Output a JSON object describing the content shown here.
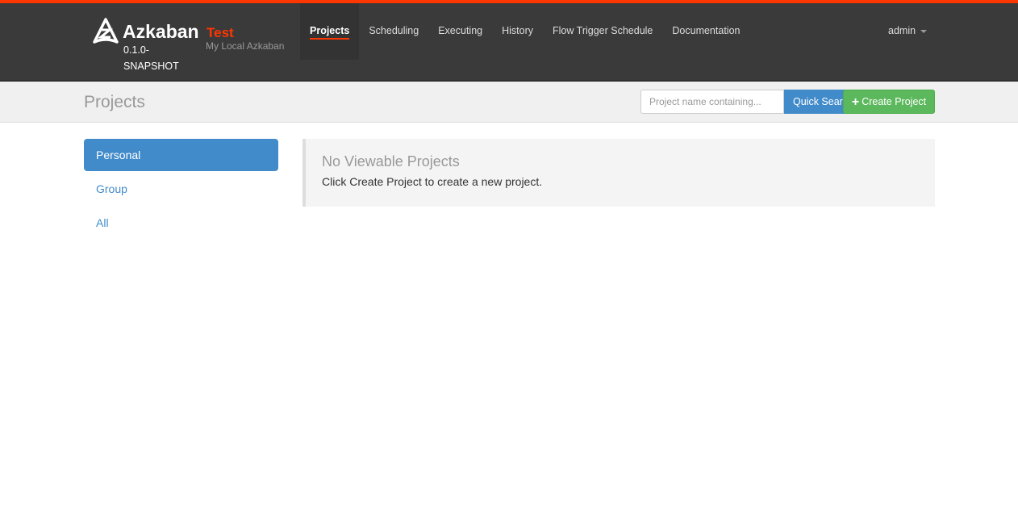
{
  "header": {
    "brand": "Azkaban",
    "version": "0.1.0-SNAPSHOT",
    "env_name": "Test",
    "env_desc": "My Local Azkaban",
    "nav": [
      {
        "label": "Projects",
        "active": true
      },
      {
        "label": "Scheduling"
      },
      {
        "label": "Executing"
      },
      {
        "label": "History"
      },
      {
        "label": "Flow Trigger Schedule"
      },
      {
        "label": "Documentation"
      }
    ],
    "user": "admin",
    "accent": "#ff3601"
  },
  "subheader": {
    "title": "Projects",
    "search_placeholder": "Project name containing...",
    "search_value": "",
    "quick_search_label": "Quick Search",
    "create_label": "Create Project"
  },
  "sidebar": {
    "items": [
      {
        "label": "Personal",
        "active": true
      },
      {
        "label": "Group"
      },
      {
        "label": "All"
      }
    ]
  },
  "main": {
    "empty_title": "No Viewable Projects",
    "empty_text": "Click Create Project to create a new project."
  }
}
